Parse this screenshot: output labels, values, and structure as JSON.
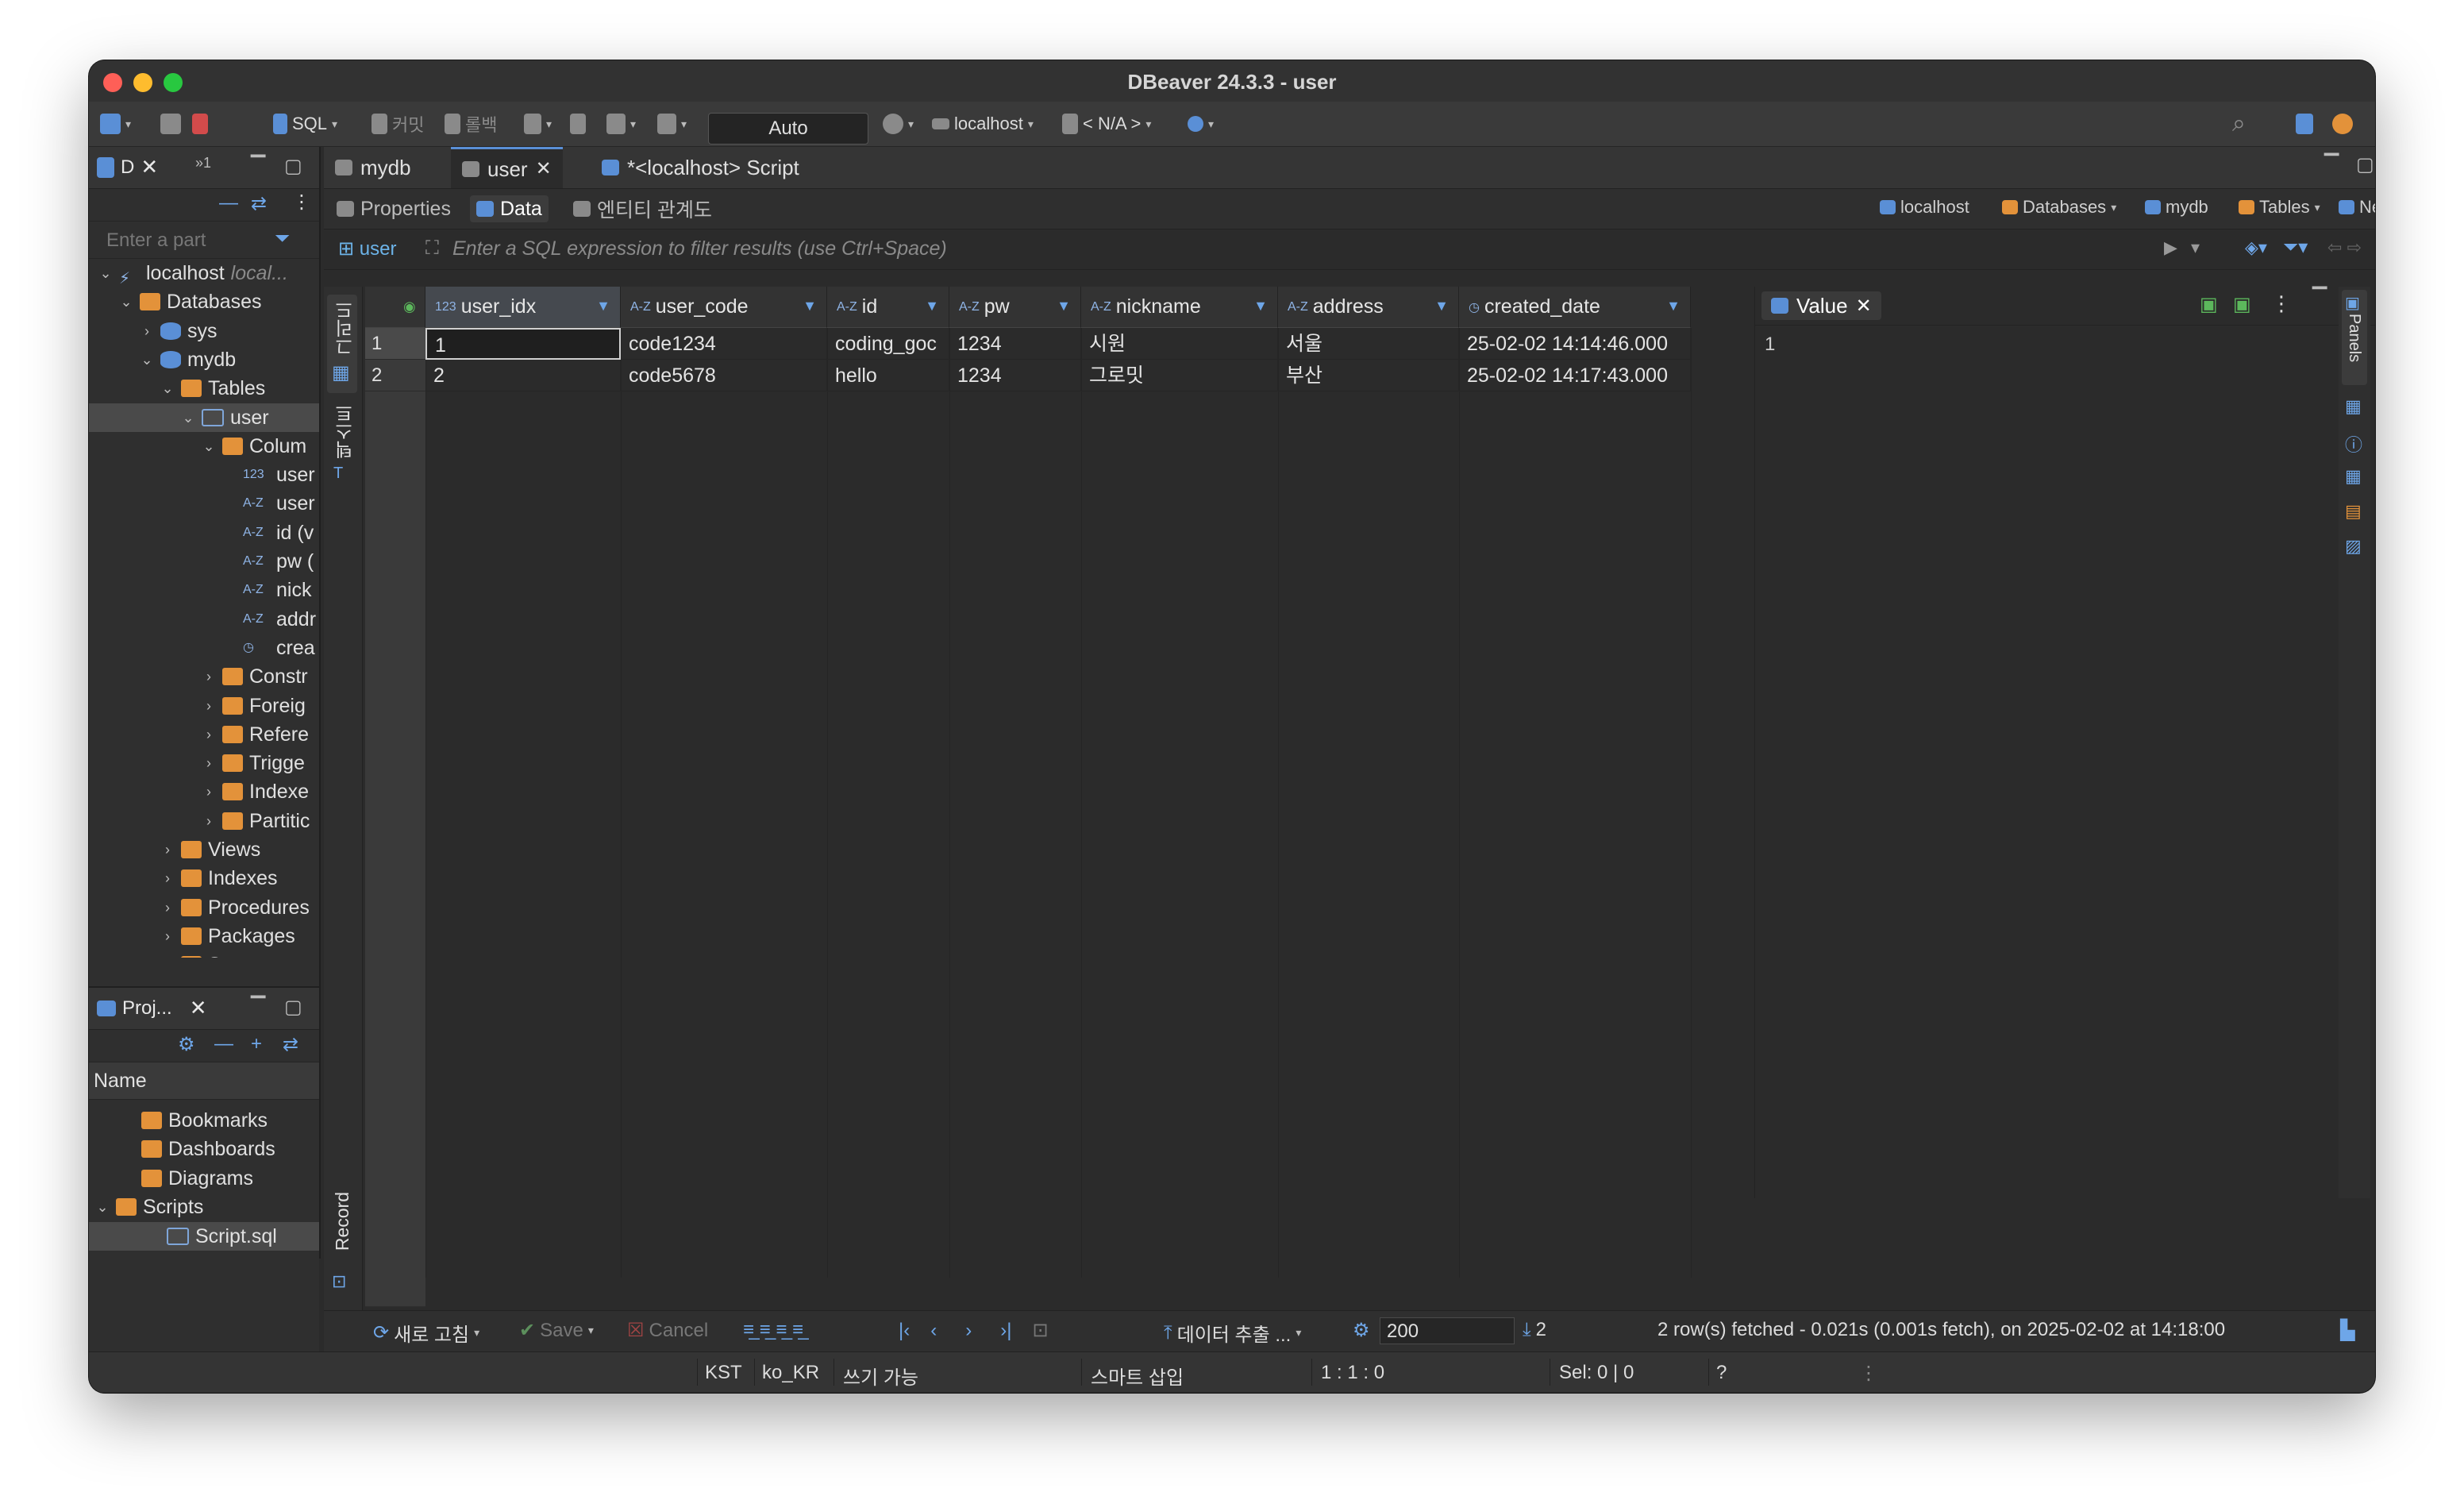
{
  "window": {
    "title": "DBeaver 24.3.3 - user"
  },
  "toolbar": {
    "sql_label": "SQL",
    "commit_label": "커밋",
    "rollback_label": "롤백",
    "mode_value": "Auto",
    "connection_label": "localhost",
    "schema_label": "< N/A >"
  },
  "navigator": {
    "tab_label": "D",
    "filter_placeholder": "Enter a part",
    "tree": [
      {
        "label": "localhost",
        "sub": "local...",
        "level": 0,
        "type": "conn",
        "open": true
      },
      {
        "label": "Databases",
        "level": 1,
        "type": "folder",
        "open": true
      },
      {
        "label": "sys",
        "level": 2,
        "type": "db",
        "open": false
      },
      {
        "label": "mydb",
        "level": 2,
        "type": "db",
        "open": true
      },
      {
        "label": "Tables",
        "level": 3,
        "type": "folder",
        "open": true
      },
      {
        "label": "user",
        "level": 4,
        "type": "table",
        "open": true,
        "selected": true
      },
      {
        "label": "Colum",
        "level": 5,
        "type": "folder",
        "open": true
      },
      {
        "label": "user",
        "level": 6,
        "type": "col",
        "prefix": "123"
      },
      {
        "label": "user",
        "level": 6,
        "type": "col",
        "prefix": "A-Z"
      },
      {
        "label": "id (v",
        "level": 6,
        "type": "col",
        "prefix": "A-Z"
      },
      {
        "label": "pw (",
        "level": 6,
        "type": "col",
        "prefix": "A-Z"
      },
      {
        "label": "nick",
        "level": 6,
        "type": "col",
        "prefix": "A-Z"
      },
      {
        "label": "addr",
        "level": 6,
        "type": "col",
        "prefix": "A-Z"
      },
      {
        "label": "crea",
        "level": 6,
        "type": "col",
        "prefix": "◷"
      },
      {
        "label": "Constr",
        "level": 5,
        "type": "folder",
        "open": false
      },
      {
        "label": "Foreig",
        "level": 5,
        "type": "folder",
        "open": false
      },
      {
        "label": "Refere",
        "level": 5,
        "type": "folder",
        "open": false
      },
      {
        "label": "Trigge",
        "level": 5,
        "type": "folder",
        "open": false
      },
      {
        "label": "Indexe",
        "level": 5,
        "type": "folder",
        "open": false
      },
      {
        "label": "Partitic",
        "level": 5,
        "type": "folder",
        "open": false
      },
      {
        "label": "Views",
        "level": 3,
        "type": "folder",
        "open": false
      },
      {
        "label": "Indexes",
        "level": 3,
        "type": "folder",
        "open": false
      },
      {
        "label": "Procedures",
        "level": 3,
        "type": "folder",
        "open": false
      },
      {
        "label": "Packages",
        "level": 3,
        "type": "folder",
        "open": false
      },
      {
        "label": "Sequences",
        "level": 3,
        "type": "folder",
        "open": false
      }
    ]
  },
  "projects": {
    "tab_label": "Proj...",
    "name_header": "Name",
    "items": [
      {
        "label": "Bookmarks",
        "level": 1
      },
      {
        "label": "Dashboards",
        "level": 1
      },
      {
        "label": "Diagrams",
        "level": 1
      },
      {
        "label": "Scripts",
        "level": 0,
        "open": true
      },
      {
        "label": "Script.sql",
        "level": 2,
        "selected": true
      }
    ]
  },
  "editor_tabs": [
    {
      "label": "mydb",
      "active": false
    },
    {
      "label": "user",
      "active": true
    },
    {
      "label": "*<localhost> Script",
      "active": false
    }
  ],
  "sub_tabs": [
    {
      "label": "Properties",
      "active": false
    },
    {
      "label": "Data",
      "active": true
    },
    {
      "label": "엔티티 관계도",
      "active": false
    }
  ],
  "breadcrumb": [
    "localhost",
    "Databases",
    "mydb",
    "Tables",
    "NewTable"
  ],
  "filter": {
    "table_tag": "user",
    "placeholder": "Enter a SQL expression to filter results (use Ctrl+Space)"
  },
  "side_labels": {
    "grid": "그리드",
    "text": "텍스트",
    "record": "Record",
    "panels": "Panels"
  },
  "grid": {
    "columns": [
      {
        "name": "user_idx",
        "type": "123"
      },
      {
        "name": "user_code",
        "type": "A-Z"
      },
      {
        "name": "id",
        "type": "A-Z"
      },
      {
        "name": "pw",
        "type": "A-Z"
      },
      {
        "name": "nickname",
        "type": "A-Z"
      },
      {
        "name": "address",
        "type": "A-Z"
      },
      {
        "name": "created_date",
        "type": "◷"
      }
    ],
    "rows": [
      {
        "num": "1",
        "cells": [
          "1",
          "code1234",
          "coding_goc",
          "1234",
          "시원",
          "서울",
          "25-02-02 14:14:46.000"
        ]
      },
      {
        "num": "2",
        "cells": [
          "2",
          "code5678",
          "hello",
          "1234",
          "그로밋",
          "부산",
          "25-02-02 14:17:43.000"
        ]
      }
    ]
  },
  "value_panel": {
    "title": "Value",
    "content": "1"
  },
  "grid_toolbar": {
    "refresh": "새로 고침",
    "save": "Save",
    "cancel": "Cancel",
    "export": "데이터 추출 ...",
    "fetch_size": "200",
    "row_count": "2",
    "status": "2 row(s) fetched - 0.021s (0.001s fetch), on 2025-02-02 at 14:18:00"
  },
  "statusbar": {
    "timezone": "KST",
    "locale": "ko_KR",
    "mode": "쓰기 가능",
    "insert": "스마트 삽입",
    "position": "1 : 1 : 0",
    "selection": "Sel: 0 | 0",
    "help": "?"
  }
}
